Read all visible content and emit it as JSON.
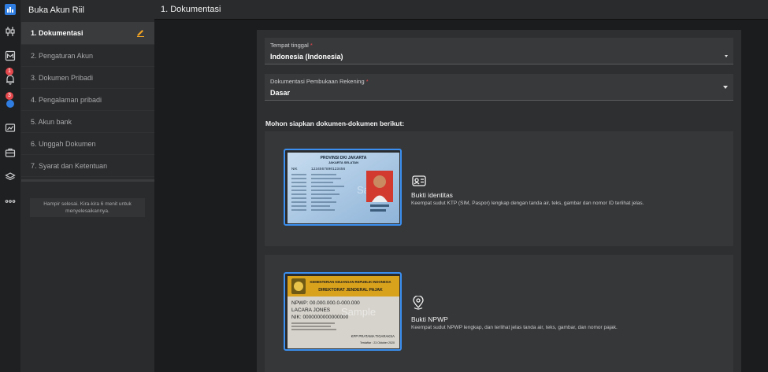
{
  "sidebar": {
    "title": "Buka Akun Riil",
    "steps": [
      {
        "label": "1. Dokumentasi"
      },
      {
        "label": "2. Pengaturan Akun"
      },
      {
        "label": "3. Dokumen Pribadi"
      },
      {
        "label": "4. Pengalaman pribadi"
      },
      {
        "label": "5. Akun bank"
      },
      {
        "label": "6. Unggah Dokumen"
      },
      {
        "label": "7. Syarat dan Ketentuan"
      }
    ],
    "note": "Hampir selesai. Kira-kira 6 menit untuk menyelesaikannya."
  },
  "rail": {
    "icons": [
      "logo-icon",
      "candlestick-icon",
      "market-icon",
      "bell-icon",
      "chat-icon",
      "chart-icon",
      "briefcase-icon",
      "layers-icon",
      "more-icon"
    ],
    "notifications_count": "1",
    "chat_count": "3"
  },
  "header": {
    "title": "1. Dokumentasi"
  },
  "form": {
    "residence": {
      "label": "Tempat tinggal",
      "required": "*",
      "value": "Indonesia (Indonesia)"
    },
    "account_docs": {
      "label": "Dokumentasi Pembukaan Rekening",
      "required": "*",
      "value": "Dasar"
    },
    "instruction": "Mohon siapkan dokumen-dokumen berikut:"
  },
  "documents": [
    {
      "title": "Bukti identitas",
      "description": "Keempat sudut KTP (SIM, Paspor) lengkap dengan tanda air, teks, gambar dan nomor ID terlihat jelas.",
      "icon": "id-card-icon",
      "sample": {
        "header1": "PROVINSI DKI JAKARTA",
        "header2": "JAKARTA SELATAN",
        "nik_label": "NIK",
        "nik": "1234567890123456",
        "watermark": "Sample"
      }
    },
    {
      "title": "Bukti NPWP",
      "description": "Keempat sudut NPWP lengkap, dan terlihat jelas tanda air, teks, gambar, dan nomor pajak.",
      "icon": "location-pin-icon",
      "sample": {
        "header1": "KEMENTERIAN KEUANGAN REPUBLIK INDONESIA",
        "header2": "DIREKTORAT JENDERAL PAJAK",
        "npwp": "NPWP: 00.000.000.0-000.000",
        "name": "LACARA JONES",
        "nik": "NIK: 0000000000000000",
        "office": "KPP PRATAMA TIGARAKSA",
        "date": "Terdaftar : 23 Oktober 2020",
        "watermark": "Sample"
      }
    }
  ],
  "colors": {
    "accent": "#3b8ff0",
    "badge": "#e5484d",
    "edit": "#f5a623"
  }
}
